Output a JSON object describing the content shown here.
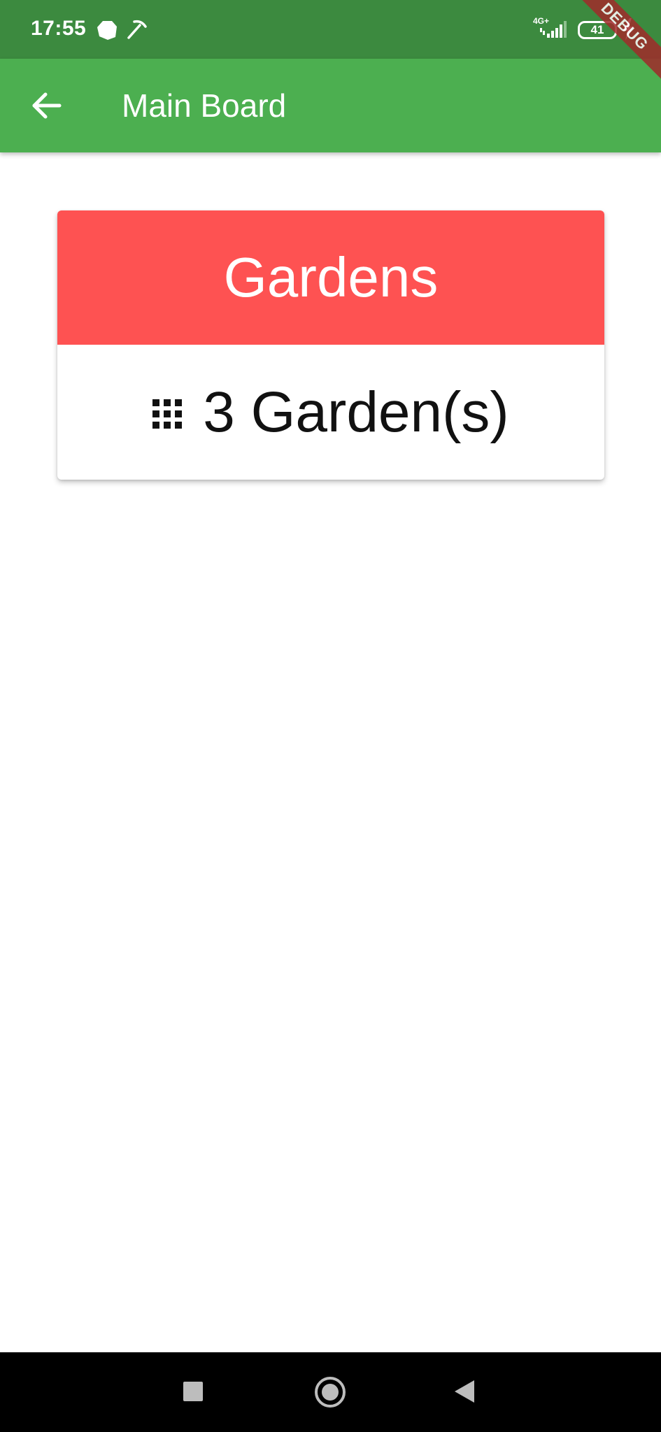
{
  "status_bar": {
    "time": "17:55",
    "network_label": "4G+",
    "battery_level": "41",
    "icons": [
      "app-notification-icon",
      "pickaxe-icon",
      "signal-icon",
      "battery-icon",
      "charging-bolt-icon"
    ]
  },
  "debug_banner": "DEBUG",
  "app_bar": {
    "title": "Main Board",
    "back_icon": "arrow-back-icon",
    "color": "#4caf50"
  },
  "card": {
    "header_title": "Gardens",
    "header_color": "#fe5252",
    "count_text": "3 Garden(s)",
    "icon": "grid-icon"
  },
  "nav_bar": {
    "icons": [
      "recents-icon",
      "home-icon",
      "back-icon"
    ]
  }
}
